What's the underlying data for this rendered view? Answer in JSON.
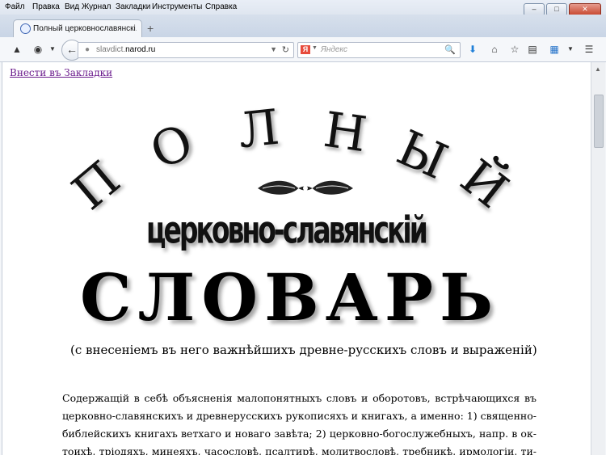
{
  "menubar": {
    "items": [
      "Файл",
      "Правка",
      "Вид",
      "Журнал",
      "Закладки",
      "Инструменты",
      "Справка"
    ]
  },
  "tab": {
    "title": "Полный церковнославянскі..."
  },
  "navbar": {
    "url_host": "slavdict.",
    "url_domain": "narod.ru",
    "search_placeholder": "Яндекс",
    "search_engine_letter": "Я"
  },
  "content": {
    "bookmark_link": "Внести въ Закладки",
    "arc_title": [
      "П",
      "О",
      "Л",
      "Н",
      "Ы",
      "Й"
    ],
    "subtitle": "церковно-славянскій",
    "main_word": "СЛОВАРЬ",
    "tagline": "(с внесеніемъ въ него важнѣйшихъ древне-русскихъ словъ и выраженій)",
    "body_lines": [
      "Содержащій в себѣ объясненія малопонятныхъ словъ и оборотовъ, встрѣчающихся въ",
      "церковно-славянскихъ и древнерусскихъ рукописяхъ и книгахъ, а именно: 1) священно-",
      "библейскихъ книгахъ ветхаго и новаго завѣта; 2) церковно-богослужебныхъ, напр. в ок-",
      "тоихѣ, тріодяхъ, минеяхъ, часословѣ, псалтирѣ, молитвословѣ, требникѣ, ирмологіи, ти-"
    ]
  },
  "colors": {
    "link_visited": "#6a1a8c",
    "close_button": "#c7442c"
  }
}
